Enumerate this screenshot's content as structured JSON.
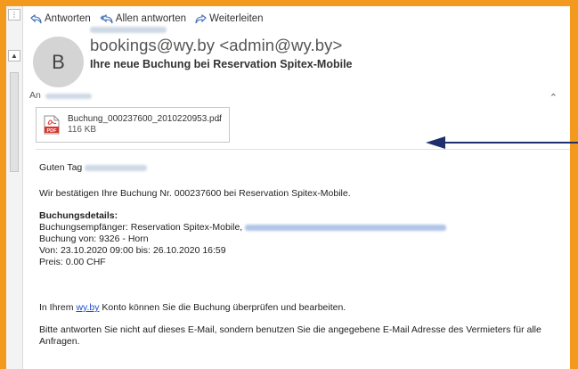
{
  "toolbar": {
    "reply_label": "Antworten",
    "reply_all_label": "Allen antworten",
    "forward_label": "Weiterleiten"
  },
  "message": {
    "avatar_initial": "B",
    "sender": "bookings@wy.by <admin@wy.by>",
    "subject": "Ihre neue Buchung bei Reservation Spitex-Mobile",
    "to_label": "An"
  },
  "attachment": {
    "filename": "Buchung_000237600_2010220953.pdf",
    "size": "116 KB",
    "icon": "pdf-icon"
  },
  "body": {
    "greeting": "Guten Tag",
    "confirmation": "Wir bestätigen Ihre Buchung Nr. 000237600 bei Reservation Spitex-Mobile.",
    "details_heading": "Buchungsdetails:",
    "recipient_prefix": "Buchungsempfänger: Reservation Spitex-Mobile,",
    "booked_from": "Buchung von: 9326 - Horn",
    "period": "Von: 23.10.2020 09:00 bis: 26.10.2020 16:59",
    "price": "Preis: 0.00 CHF",
    "account_prefix": "In Ihrem",
    "account_link": "wy.by",
    "account_suffix": "Konto können Sie die Buchung überprüfen und bearbeiten.",
    "no_reply": "Bitte antworten Sie nicht auf dieses E-Mail, sondern benutzen Sie die angegebene E-Mail Adresse des Vermieters für alle Anfragen."
  },
  "colors": {
    "frame": "#F39A1E",
    "arrow": "#1F2F6E",
    "link": "#1F4FCB",
    "pdf_red": "#D9342B"
  }
}
